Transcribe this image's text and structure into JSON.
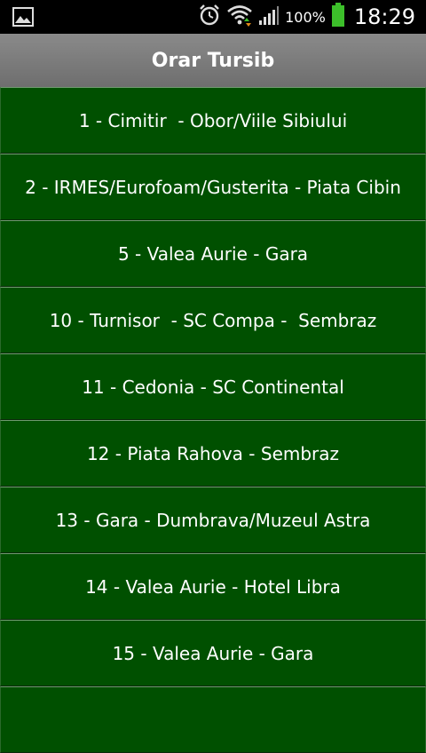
{
  "status_bar": {
    "left_icon": "image-icon",
    "battery_percent": "100%",
    "time": "18:29",
    "battery_color": "#3cbf2a"
  },
  "header": {
    "title": "Orar Tursib"
  },
  "colors": {
    "item_background": "#005000",
    "title_bar": "#7a7a7a"
  },
  "routes": [
    "1 - Cimitir  - Obor/Viile Sibiului",
    "2 - IRMES/Eurofoam/Gusterita - Piata Cibin",
    "5 - Valea Aurie - Gara",
    "10 - Turnisor  - SC Compa -  Sembraz",
    "11 - Cedonia - SC Continental",
    "12 - Piata Rahova - Sembraz",
    "13 - Gara - Dumbrava/Muzeul Astra",
    "14 - Valea Aurie - Hotel Libra",
    "15 - Valea Aurie - Gara",
    ""
  ]
}
